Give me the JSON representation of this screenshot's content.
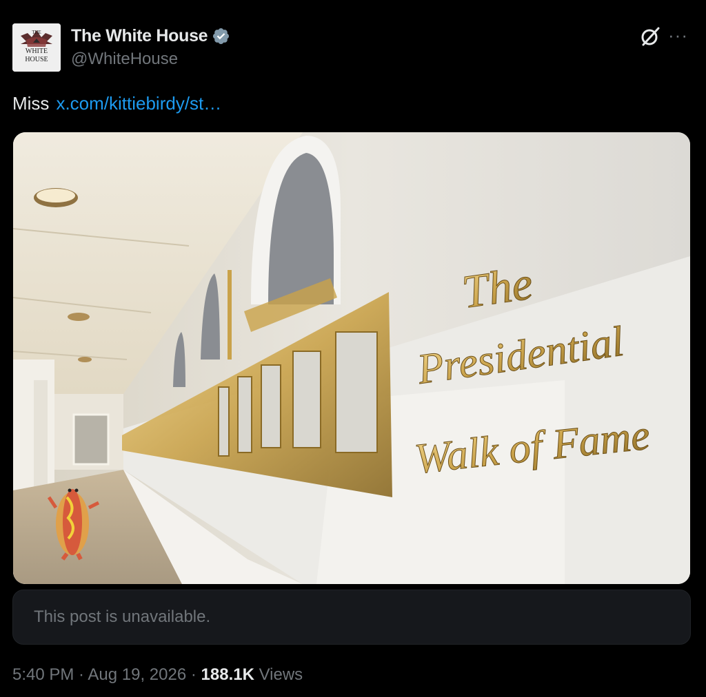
{
  "author": {
    "name": "The White House",
    "handle": "@WhiteHouse",
    "avatar_text": [
      "THE",
      "WHITE",
      "HOUSE"
    ]
  },
  "icons": {
    "verified": "verified-badge-icon",
    "grok": "grok-icon",
    "more": "more-options-icon"
  },
  "post": {
    "text": "Miss",
    "link": "x.com/kittiebirdy/st…"
  },
  "media": {
    "sign_lines": [
      "The",
      "Presidential",
      "Walk of Fame"
    ]
  },
  "quoted": {
    "unavailable_text": "This post is unavailable."
  },
  "meta": {
    "time": "5:40 PM",
    "sep1": " · ",
    "date": "Aug 19, 2026",
    "sep2": " · ",
    "views_count": "188.1K",
    "views_label": " Views"
  },
  "colors": {
    "background": "#000000",
    "link": "#1d9bf0",
    "verified": "#829aab",
    "secondary_text": "#71767b",
    "gold": "#c9a24a"
  }
}
